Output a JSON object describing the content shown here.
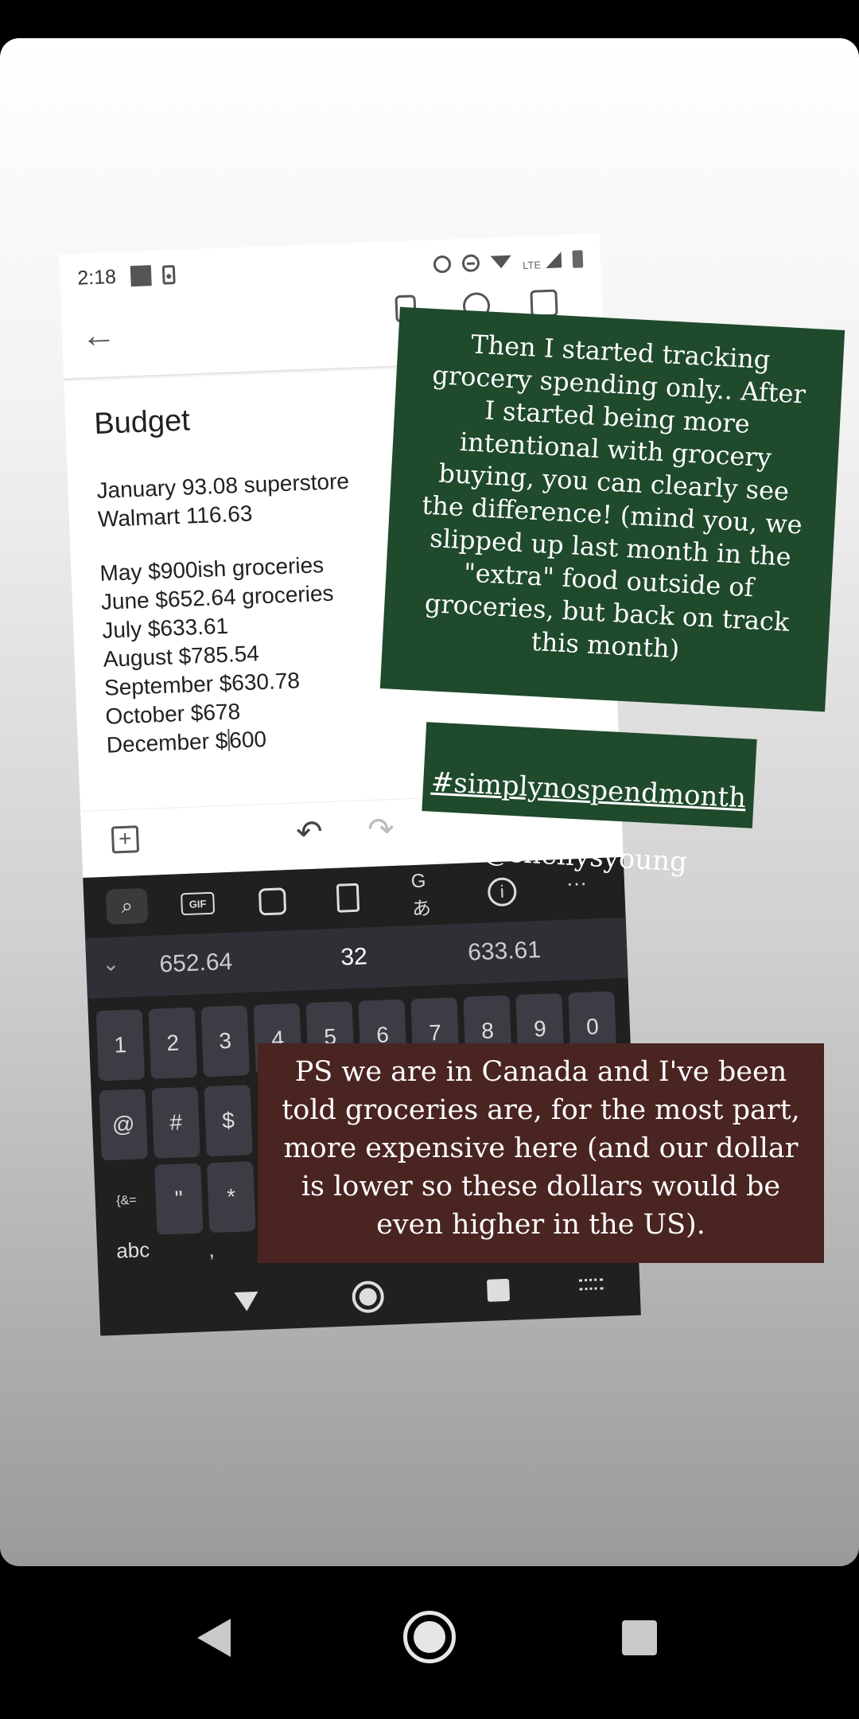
{
  "status_bar": {
    "time": "2:18",
    "network_label": "LTE"
  },
  "note": {
    "title": "Budget",
    "lines_block1": [
      "January 93.08 superstore",
      "Walmart 116.63"
    ],
    "lines_block2": [
      "May $900ish groceries",
      "June $652.64 groceries",
      "July $633.61",
      "August $785.54",
      "September $630.78",
      "October $678"
    ],
    "last_line_before_caret": "December $",
    "last_line_after_caret": "600"
  },
  "keyboard": {
    "toolbar": {
      "gif_label": "GIF",
      "more_label": "···",
      "translate_glyph": "Gあ",
      "info_glyph": "i",
      "search_glyph": "⌕"
    },
    "suggestions": [
      "652.64",
      "32",
      "633.61"
    ],
    "number_row": [
      "1",
      "2",
      "3",
      "4",
      "5",
      "6",
      "7",
      "8",
      "9",
      "0"
    ],
    "symbol_row": [
      "@",
      "#",
      "$"
    ],
    "third_row": [
      "{&=",
      "\"",
      "*"
    ],
    "abc_label": "abc",
    "comma_label": ","
  },
  "overlays": {
    "green_text": "Then I started tracking\ngrocery spending only.. After\nI started being more\nintentional with grocery\nbuying, you can clearly see\nthe difference! (mind you, we\nslipped up last month in the\n\"extra\" food outside of\ngroceries, but back on track\nthis month)",
    "hashtag": "#simplynospendmonth",
    "handle": "@shellysyoung",
    "maroon_text": "PS we are in Canada and I've been\ntold groceries are, for the most part,\nmore expensive here (and our dollar\nis lower so these dollars would be\neven higher in the US)."
  },
  "colors": {
    "green_overlay": "#1f4a2c",
    "maroon_overlay": "#4a2421",
    "keyboard_bg": "#202020"
  }
}
